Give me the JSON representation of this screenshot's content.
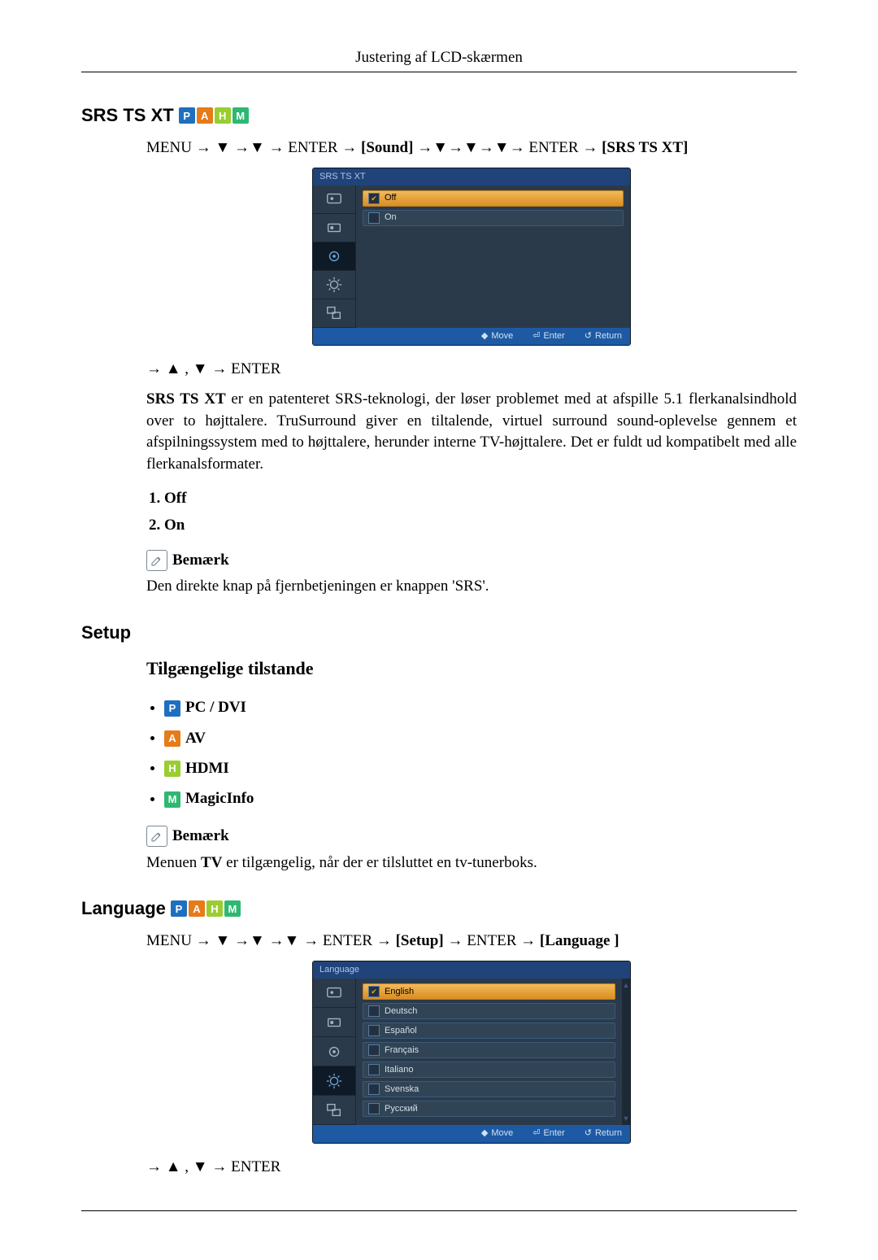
{
  "header": {
    "running": "Justering af LCD-skærmen"
  },
  "srs": {
    "title": "SRS TS XT",
    "path_pre": "MENU → ▼ →▼ → ENTER → ",
    "path_sound": "[Sound]",
    "path_mid": " →▼→▼→▼→ ENTER → ",
    "path_target": "[SRS TS XT]",
    "nav_after": "→ ▲ , ▼ → ENTER",
    "desc_pre": "SRS TS XT",
    "desc": " er en patenteret SRS-teknologi, der løser problemet med at afspille 5.1 flerkanalsindhold over to højttalere. TruSurround giver en tiltalende, virtuel surround sound-oplevelse gennem et afspilningssystem med to højttalere, herunder interne TV-højttalere. Det er fuldt ud kompatibelt med alle flerkanalsformater.",
    "options": [
      "Off",
      "On"
    ],
    "note_label": "Bemærk",
    "note_text": "Den direkte knap på fjernbetjeningen er knappen 'SRS'."
  },
  "srs_osd": {
    "title": "SRS TS  XT",
    "items": [
      {
        "label": "Off",
        "checked": true,
        "selected": true
      },
      {
        "label": "On",
        "checked": false,
        "selected": false
      }
    ],
    "foot": {
      "move": "Move",
      "enter": "Enter",
      "return": "Return"
    }
  },
  "setup": {
    "title": "Setup",
    "modes_heading": "Tilgængelige tilstande",
    "modes": [
      {
        "badge": "P",
        "cls": "b-p",
        "label": " PC / DVI"
      },
      {
        "badge": "A",
        "cls": "b-a",
        "label": " AV"
      },
      {
        "badge": "H",
        "cls": "b-h",
        "label": " HDMI"
      },
      {
        "badge": "M",
        "cls": "b-m",
        "label": " MagicInfo"
      }
    ],
    "note_label": "Bemærk",
    "note_pre": "Menuen ",
    "note_bold": "TV",
    "note_post": " er tilgængelig, når der er tilsluttet en tv-tunerboks."
  },
  "language": {
    "title": "Language",
    "path_pre": "MENU → ▼ →▼ →▼ → ENTER → ",
    "path_setup": "[Setup]",
    "path_mid": " → ENTER → ",
    "path_target": "[Language ]",
    "nav_after": "→ ▲ , ▼ → ENTER"
  },
  "lang_osd": {
    "title": "Language",
    "items": [
      {
        "label": "English",
        "checked": true,
        "selected": true
      },
      {
        "label": "Deutsch",
        "checked": false,
        "selected": false
      },
      {
        "label": "Español",
        "checked": false,
        "selected": false
      },
      {
        "label": "Français",
        "checked": false,
        "selected": false
      },
      {
        "label": "Italiano",
        "checked": false,
        "selected": false
      },
      {
        "label": "Svenska",
        "checked": false,
        "selected": false
      },
      {
        "label": "Русский",
        "checked": false,
        "selected": false
      }
    ],
    "foot": {
      "move": "Move",
      "enter": "Enter",
      "return": "Return"
    }
  },
  "badges": {
    "P": "P",
    "A": "A",
    "H": "H",
    "M": "M"
  }
}
